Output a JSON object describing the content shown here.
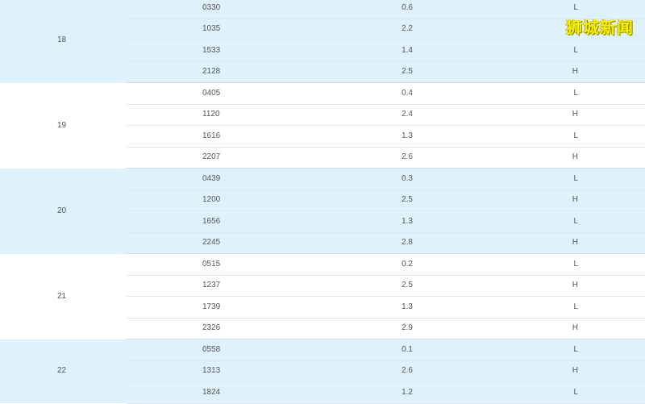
{
  "watermark": "狮城新闻",
  "tide_groups": [
    {
      "day": "18",
      "rows": [
        {
          "time": "0330",
          "height": "0.6",
          "type": "L"
        },
        {
          "time": "1035",
          "height": "2.2",
          "type": "H"
        },
        {
          "time": "1533",
          "height": "1.4",
          "type": "L"
        },
        {
          "time": "2128",
          "height": "2.5",
          "type": "H"
        }
      ]
    },
    {
      "day": "19",
      "rows": [
        {
          "time": "0405",
          "height": "0.4",
          "type": "L"
        },
        {
          "time": "1120",
          "height": "2.4",
          "type": "H"
        },
        {
          "time": "1616",
          "height": "1.3",
          "type": "L"
        },
        {
          "time": "2207",
          "height": "2.6",
          "type": "H"
        }
      ]
    },
    {
      "day": "20",
      "rows": [
        {
          "time": "0439",
          "height": "0.3",
          "type": "L"
        },
        {
          "time": "1200",
          "height": "2.5",
          "type": "H"
        },
        {
          "time": "1656",
          "height": "1.3",
          "type": "L"
        },
        {
          "time": "2245",
          "height": "2.8",
          "type": "H"
        }
      ]
    },
    {
      "day": "21",
      "rows": [
        {
          "time": "0515",
          "height": "0.2",
          "type": "L"
        },
        {
          "time": "1237",
          "height": "2.5",
          "type": "H"
        },
        {
          "time": "1739",
          "height": "1.3",
          "type": "L"
        },
        {
          "time": "2326",
          "height": "2.9",
          "type": "H"
        }
      ]
    },
    {
      "day": "22",
      "rows": [
        {
          "time": "0558",
          "height": "0.1",
          "type": "L"
        },
        {
          "time": "1313",
          "height": "2.6",
          "type": "H"
        },
        {
          "time": "1824",
          "height": "1.2",
          "type": "L"
        }
      ]
    }
  ],
  "colors": {
    "shaded_row": "#dff2fb",
    "plain_row": "#ffffff",
    "watermark": "#f7f000"
  }
}
